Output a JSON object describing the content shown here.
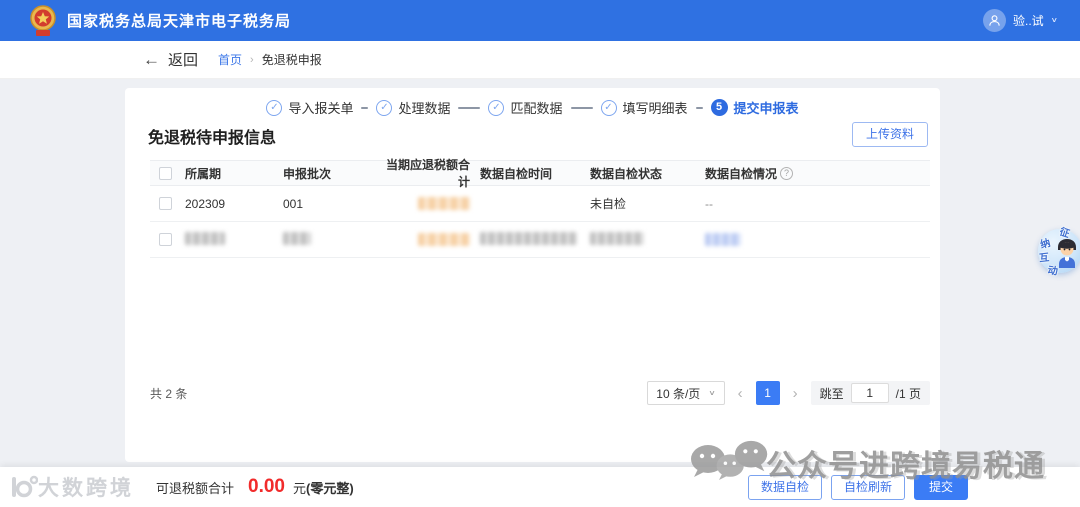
{
  "colors": {
    "accent": "#2e6be0",
    "header_bg": "#2f71e2",
    "amount_red": "#f12b2b"
  },
  "icons": {
    "check": "✓",
    "back_arrow": "←",
    "chevron_down": "∨",
    "info": "?",
    "prev": "‹",
    "next": "›",
    "crumb_sep": "›"
  },
  "header": {
    "title": "国家税务总局天津市电子税务局",
    "user_name": "验..试"
  },
  "breadcrumb": {
    "back": "返回",
    "home": "首页",
    "current": "免退税申报"
  },
  "stepper": {
    "steps": [
      {
        "label": "导入报关单",
        "state": "done"
      },
      {
        "label": "处理数据",
        "state": "done"
      },
      {
        "label": "匹配数据",
        "state": "done"
      },
      {
        "label": "填写明细表",
        "state": "done"
      },
      {
        "label": "提交申报表",
        "state": "current",
        "number": "5"
      }
    ]
  },
  "panel": {
    "title": "免退税待申报信息",
    "upload_button": "上传资料"
  },
  "table": {
    "columns": [
      "所属期",
      "申报批次",
      "当期应退税额合计",
      "数据自检时间",
      "数据自检状态",
      "数据自检情况"
    ],
    "rows": [
      {
        "period": "202309",
        "batch": "001",
        "amount_redacted": true,
        "check_time": "",
        "check_status": "未自检",
        "check_detail": "--"
      },
      {
        "all_redacted": true
      }
    ]
  },
  "pagination": {
    "total": "共 2 条",
    "page_size": "10 条/页",
    "current_page": "1",
    "jump_label": "跳至",
    "jump_value": "1",
    "jump_suffix": "/1 页"
  },
  "mascot": {
    "chars": [
      "征",
      "纳",
      "互",
      "动"
    ]
  },
  "footer": {
    "brand": "大数跨境",
    "refund_label": "可退税额合计",
    "refund_amount": "0.00",
    "refund_unit_prefix": "元",
    "refund_unit_bold": "(零元整)",
    "check_button": "数据自检",
    "refresh_button": "自检刷新",
    "submit_button": "提交"
  },
  "watermark": {
    "text": "公众号进跨境易税通"
  }
}
